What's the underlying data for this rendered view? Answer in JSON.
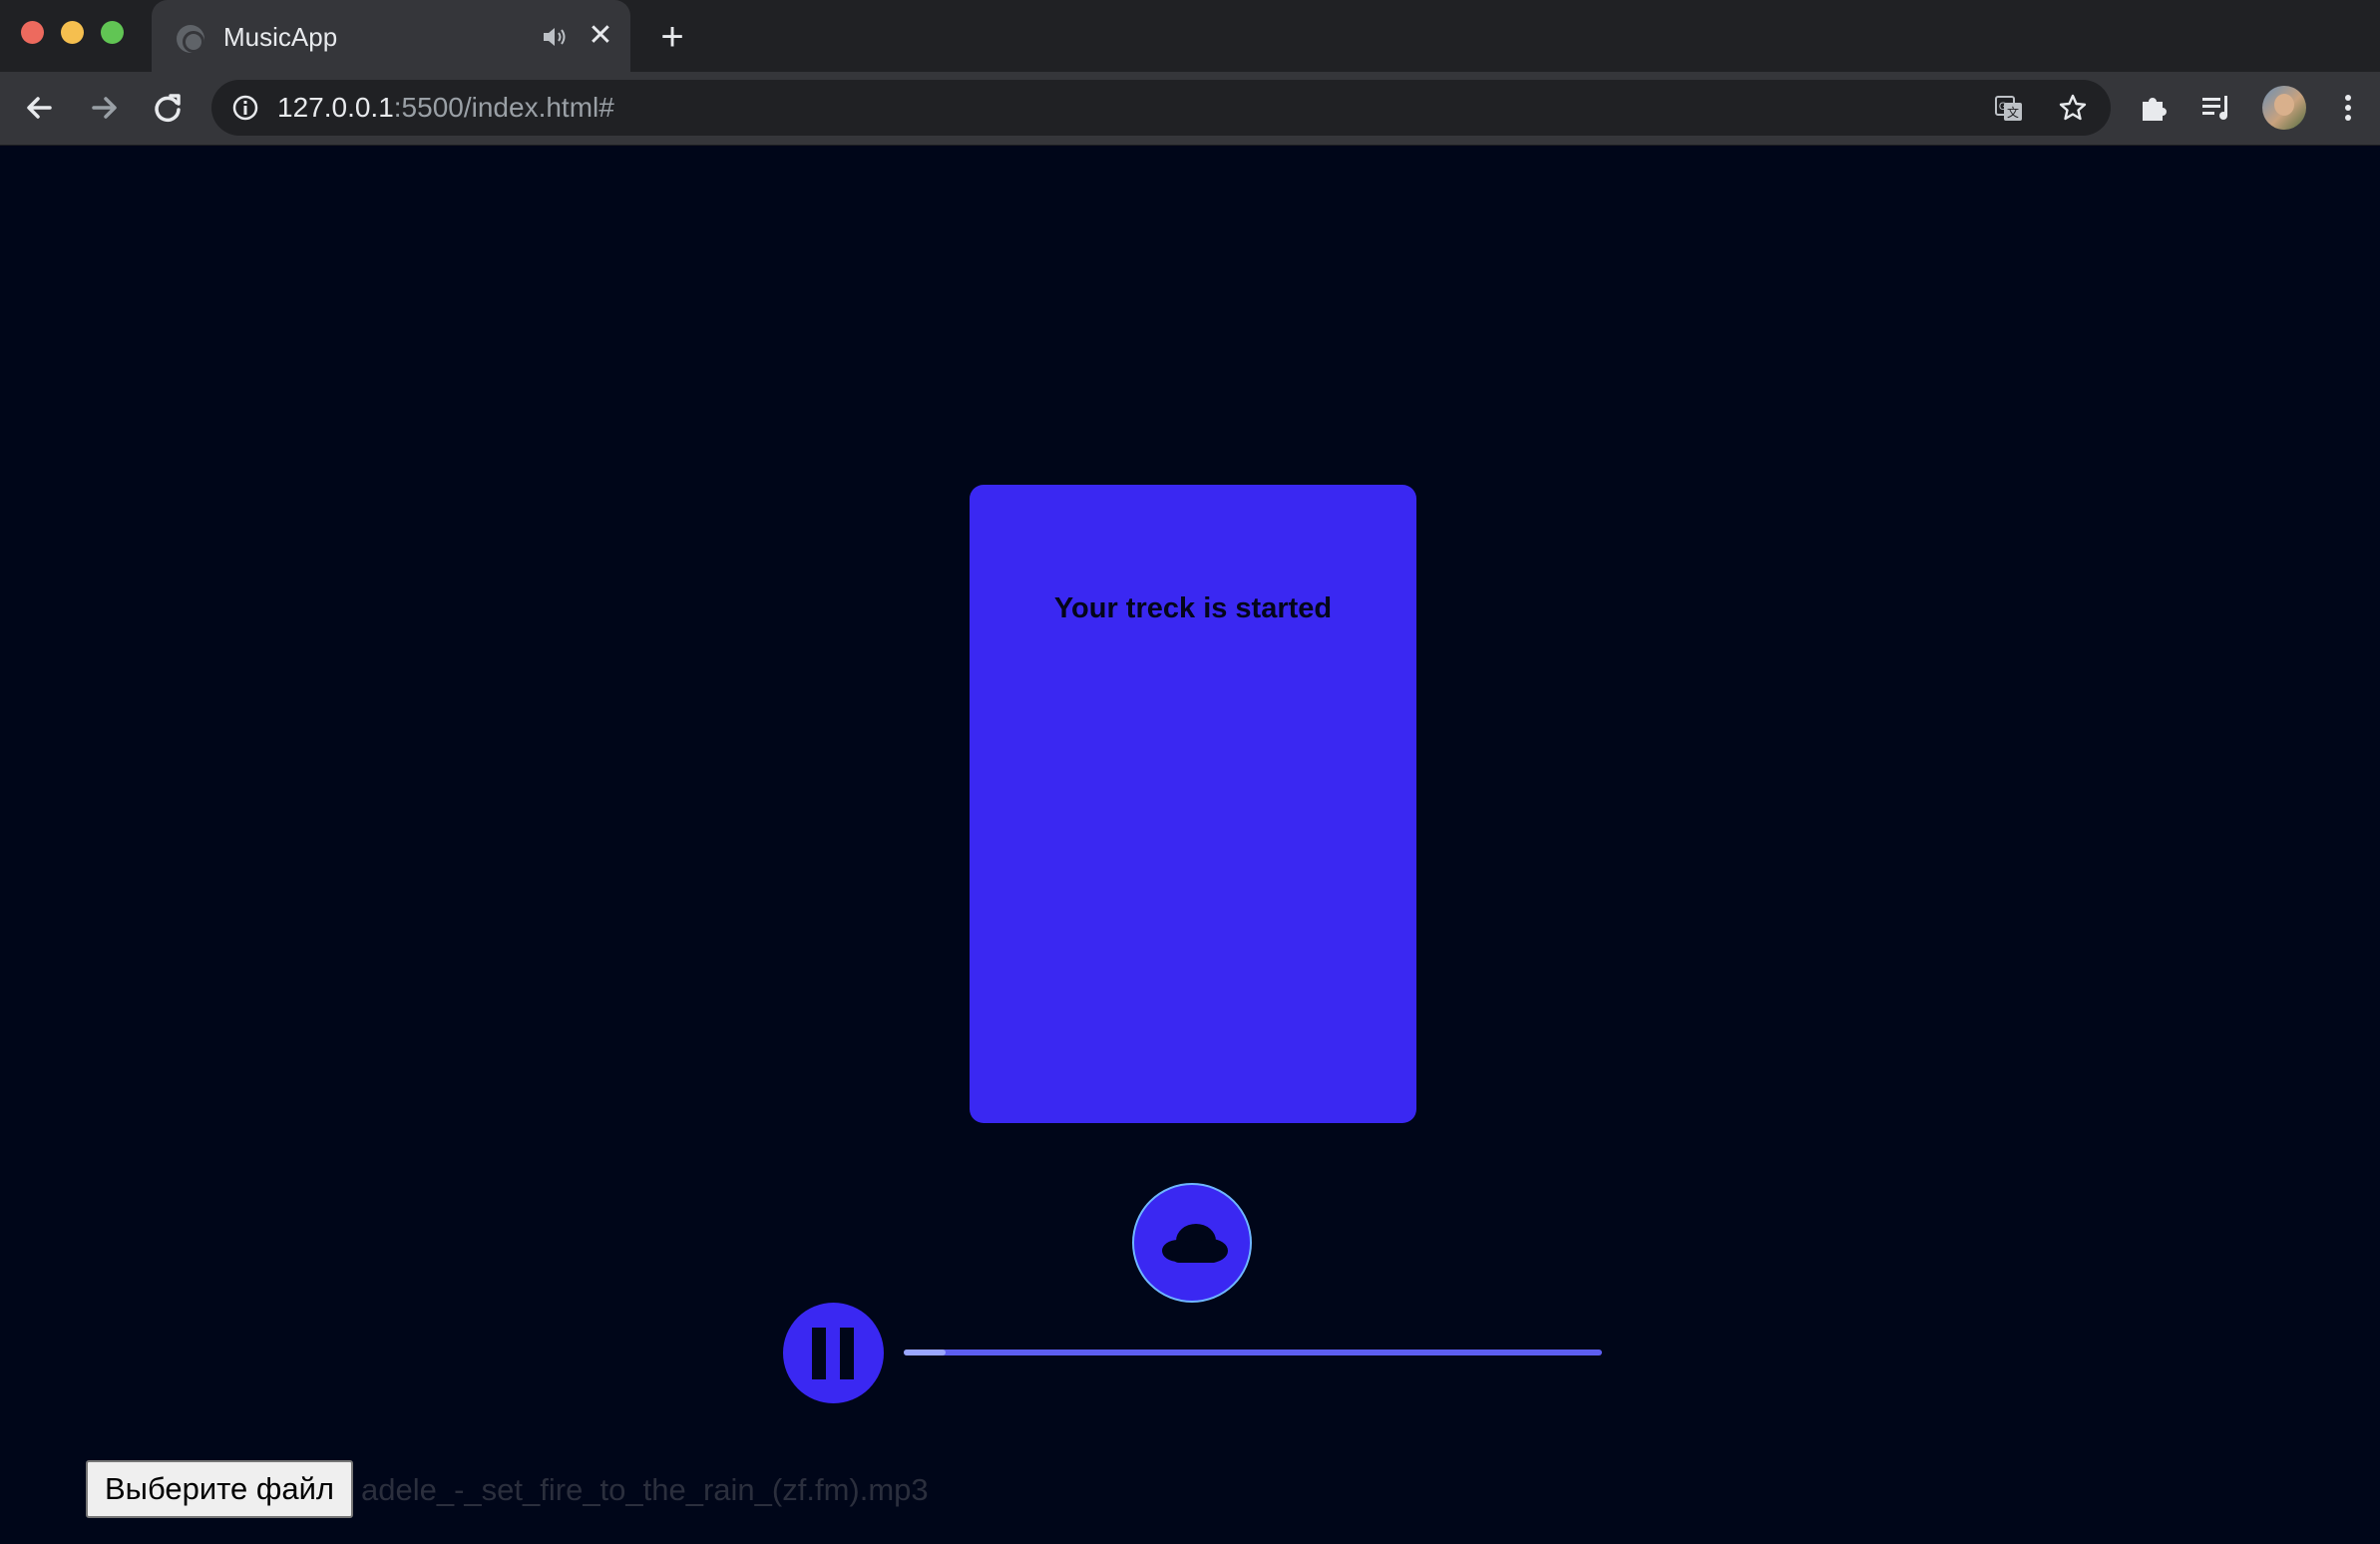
{
  "browser": {
    "tab": {
      "title": "MusicApp",
      "audio_icon": "speaker-icon",
      "close_label": "✕"
    },
    "new_tab_label": "+",
    "address": {
      "host": "127.0.0.1",
      "rest": ":5500/index.html#"
    }
  },
  "card": {
    "status_text": "Your treck is started"
  },
  "player": {
    "state": "playing",
    "progress_fraction": 0.06,
    "accent": "#3a28f2",
    "track_color": "#5d5ef0"
  },
  "file_input": {
    "button_label": "Выберите файл",
    "file_name": "adele_-_set_fire_to_the_rain_(zf.fm).mp3"
  },
  "colors": {
    "page_bg": "#000619",
    "chrome_dark": "#202124",
    "chrome_light": "#35363a"
  }
}
